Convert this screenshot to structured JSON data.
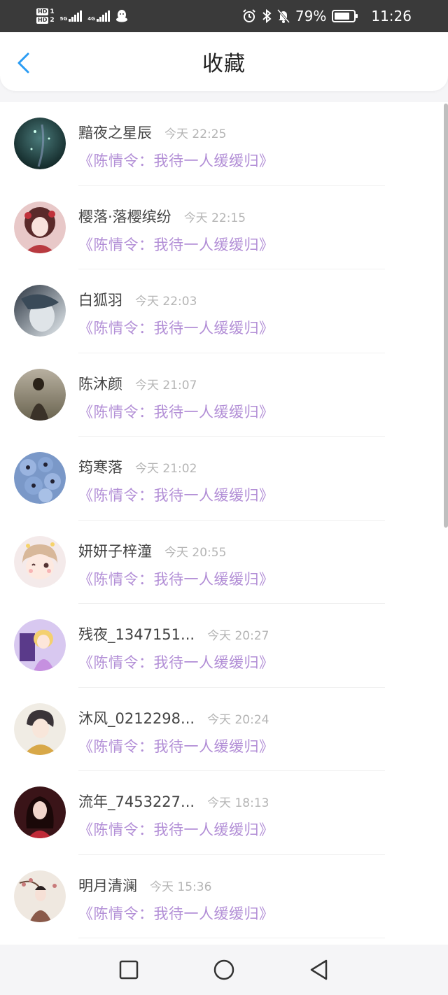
{
  "status_bar": {
    "hd1": "HD",
    "hd1_num": "1",
    "hd2": "HD",
    "hd2_num": "2",
    "net1": "5G",
    "net2": "4G",
    "battery_percent": "79%",
    "battery_level": 0.79,
    "time": "11:26"
  },
  "header": {
    "title": "收藏",
    "back_icon": "chevron-left-icon",
    "accent_color": "#2a9cf4"
  },
  "colors": {
    "username": "#444444",
    "time": "#b5b5b5",
    "work_link": "#b28ed6"
  },
  "items": [
    {
      "username": "黯夜之星辰",
      "time": "今天 22:25",
      "work": "《陈情令：我待一人缓缓归》"
    },
    {
      "username": "樱落·落樱缤纷",
      "time": "今天 22:15",
      "work": "《陈情令：我待一人缓缓归》"
    },
    {
      "username": "白狐羽",
      "time": "今天 22:03",
      "work": "《陈情令：我待一人缓缓归》"
    },
    {
      "username": "陈沐颜",
      "time": "今天 21:07",
      "work": "《陈情令：我待一人缓缓归》"
    },
    {
      "username": "筠寒落",
      "time": "今天 21:02",
      "work": "《陈情令：我待一人缓缓归》"
    },
    {
      "username": "妍妍子梓潼",
      "time": "今天 20:55",
      "work": "《陈情令：我待一人缓缓归》"
    },
    {
      "username": "残夜_1347151...",
      "time": "今天 20:27",
      "work": "《陈情令：我待一人缓缓归》"
    },
    {
      "username": "沐风_0212298...",
      "time": "今天 20:24",
      "work": "《陈情令：我待一人缓缓归》"
    },
    {
      "username": "流年_7453227...",
      "time": "今天 18:13",
      "work": "《陈情令：我待一人缓缓归》"
    },
    {
      "username": "明月清澜",
      "time": "今天 15:36",
      "work": "《陈情令：我待一人缓缓归》"
    }
  ],
  "nav": {
    "recent_icon": "square-icon",
    "home_icon": "circle-icon",
    "back_icon": "triangle-back-icon"
  }
}
